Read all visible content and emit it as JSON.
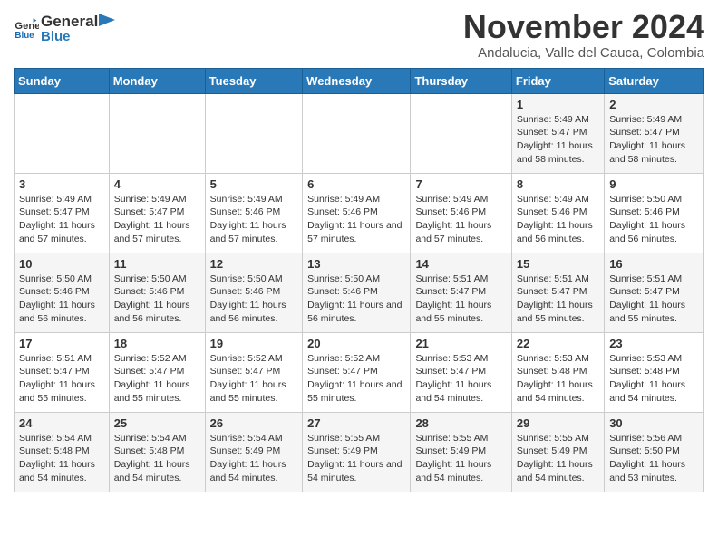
{
  "logo": {
    "line1": "General",
    "line2": "Blue"
  },
  "title": "November 2024",
  "location": "Andalucia, Valle del Cauca, Colombia",
  "days_of_week": [
    "Sunday",
    "Monday",
    "Tuesday",
    "Wednesday",
    "Thursday",
    "Friday",
    "Saturday"
  ],
  "weeks": [
    [
      {
        "day": "",
        "info": ""
      },
      {
        "day": "",
        "info": ""
      },
      {
        "day": "",
        "info": ""
      },
      {
        "day": "",
        "info": ""
      },
      {
        "day": "",
        "info": ""
      },
      {
        "day": "1",
        "info": "Sunrise: 5:49 AM\nSunset: 5:47 PM\nDaylight: 11 hours and 58 minutes."
      },
      {
        "day": "2",
        "info": "Sunrise: 5:49 AM\nSunset: 5:47 PM\nDaylight: 11 hours and 58 minutes."
      }
    ],
    [
      {
        "day": "3",
        "info": "Sunrise: 5:49 AM\nSunset: 5:47 PM\nDaylight: 11 hours and 57 minutes."
      },
      {
        "day": "4",
        "info": "Sunrise: 5:49 AM\nSunset: 5:47 PM\nDaylight: 11 hours and 57 minutes."
      },
      {
        "day": "5",
        "info": "Sunrise: 5:49 AM\nSunset: 5:46 PM\nDaylight: 11 hours and 57 minutes."
      },
      {
        "day": "6",
        "info": "Sunrise: 5:49 AM\nSunset: 5:46 PM\nDaylight: 11 hours and 57 minutes."
      },
      {
        "day": "7",
        "info": "Sunrise: 5:49 AM\nSunset: 5:46 PM\nDaylight: 11 hours and 57 minutes."
      },
      {
        "day": "8",
        "info": "Sunrise: 5:49 AM\nSunset: 5:46 PM\nDaylight: 11 hours and 56 minutes."
      },
      {
        "day": "9",
        "info": "Sunrise: 5:50 AM\nSunset: 5:46 PM\nDaylight: 11 hours and 56 minutes."
      }
    ],
    [
      {
        "day": "10",
        "info": "Sunrise: 5:50 AM\nSunset: 5:46 PM\nDaylight: 11 hours and 56 minutes."
      },
      {
        "day": "11",
        "info": "Sunrise: 5:50 AM\nSunset: 5:46 PM\nDaylight: 11 hours and 56 minutes."
      },
      {
        "day": "12",
        "info": "Sunrise: 5:50 AM\nSunset: 5:46 PM\nDaylight: 11 hours and 56 minutes."
      },
      {
        "day": "13",
        "info": "Sunrise: 5:50 AM\nSunset: 5:46 PM\nDaylight: 11 hours and 56 minutes."
      },
      {
        "day": "14",
        "info": "Sunrise: 5:51 AM\nSunset: 5:47 PM\nDaylight: 11 hours and 55 minutes."
      },
      {
        "day": "15",
        "info": "Sunrise: 5:51 AM\nSunset: 5:47 PM\nDaylight: 11 hours and 55 minutes."
      },
      {
        "day": "16",
        "info": "Sunrise: 5:51 AM\nSunset: 5:47 PM\nDaylight: 11 hours and 55 minutes."
      }
    ],
    [
      {
        "day": "17",
        "info": "Sunrise: 5:51 AM\nSunset: 5:47 PM\nDaylight: 11 hours and 55 minutes."
      },
      {
        "day": "18",
        "info": "Sunrise: 5:52 AM\nSunset: 5:47 PM\nDaylight: 11 hours and 55 minutes."
      },
      {
        "day": "19",
        "info": "Sunrise: 5:52 AM\nSunset: 5:47 PM\nDaylight: 11 hours and 55 minutes."
      },
      {
        "day": "20",
        "info": "Sunrise: 5:52 AM\nSunset: 5:47 PM\nDaylight: 11 hours and 55 minutes."
      },
      {
        "day": "21",
        "info": "Sunrise: 5:53 AM\nSunset: 5:47 PM\nDaylight: 11 hours and 54 minutes."
      },
      {
        "day": "22",
        "info": "Sunrise: 5:53 AM\nSunset: 5:48 PM\nDaylight: 11 hours and 54 minutes."
      },
      {
        "day": "23",
        "info": "Sunrise: 5:53 AM\nSunset: 5:48 PM\nDaylight: 11 hours and 54 minutes."
      }
    ],
    [
      {
        "day": "24",
        "info": "Sunrise: 5:54 AM\nSunset: 5:48 PM\nDaylight: 11 hours and 54 minutes."
      },
      {
        "day": "25",
        "info": "Sunrise: 5:54 AM\nSunset: 5:48 PM\nDaylight: 11 hours and 54 minutes."
      },
      {
        "day": "26",
        "info": "Sunrise: 5:54 AM\nSunset: 5:49 PM\nDaylight: 11 hours and 54 minutes."
      },
      {
        "day": "27",
        "info": "Sunrise: 5:55 AM\nSunset: 5:49 PM\nDaylight: 11 hours and 54 minutes."
      },
      {
        "day": "28",
        "info": "Sunrise: 5:55 AM\nSunset: 5:49 PM\nDaylight: 11 hours and 54 minutes."
      },
      {
        "day": "29",
        "info": "Sunrise: 5:55 AM\nSunset: 5:49 PM\nDaylight: 11 hours and 54 minutes."
      },
      {
        "day": "30",
        "info": "Sunrise: 5:56 AM\nSunset: 5:50 PM\nDaylight: 11 hours and 53 minutes."
      }
    ]
  ]
}
